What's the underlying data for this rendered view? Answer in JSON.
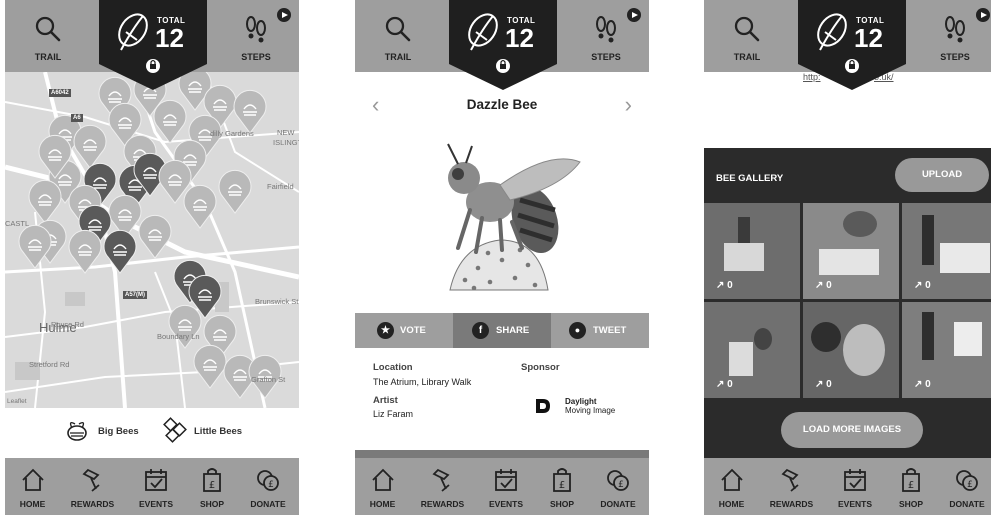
{
  "header": {
    "trail_label": "TRAIL",
    "steps_label": "STEPS",
    "total_label": "TOTAL",
    "total_value": "12"
  },
  "nav": {
    "items": [
      {
        "label": "HOME",
        "icon": "home-icon"
      },
      {
        "label": "REWARDS",
        "icon": "rewards-icon"
      },
      {
        "label": "EVENTS",
        "icon": "events-icon"
      },
      {
        "label": "SHOP",
        "icon": "shop-icon"
      },
      {
        "label": "DONATE",
        "icon": "donate-icon"
      }
    ]
  },
  "map": {
    "labels": [
      "A6042",
      "A6",
      "NEW",
      "ISLINGT",
      "dilly Gardens",
      "CASTL",
      "Fairfield",
      "A57(M)",
      "Royce Rd",
      "Hulme",
      "Brunswick St",
      "Grafton St",
      "Boundary Ln",
      "Stretford Rd",
      "Leaflet"
    ],
    "legend_big": "Big Bees",
    "legend_little": "Little Bees"
  },
  "detail": {
    "title": "Dazzle Bee",
    "vote_label": "VOTE",
    "share_label": "SHARE",
    "tweet_label": "TWEET",
    "location_heading": "Location",
    "location_value": "The Atrium, Library Walk",
    "sponsor_heading": "Sponsor",
    "artist_heading": "Artist",
    "artist_value": "Liz Faram",
    "sponsor_name_1": "Daylight",
    "sponsor_name_2": "Moving Image"
  },
  "gallery": {
    "url_text_left": "http:",
    "url_text_right": "o.uk/",
    "title": "BEE GALLERY",
    "upload_label": "UPLOAD",
    "counts": [
      "0",
      "0",
      "0",
      "0",
      "0",
      "0"
    ],
    "load_more_label": "LOAD MORE IMAGES"
  },
  "colors": {
    "bar_grey": "#9e9e9e",
    "badge": "#1f1f1f",
    "pin_light": "#b9b9b9",
    "pin_dark": "#5a5a5a",
    "gallery_bg": "#2b2b2b"
  }
}
